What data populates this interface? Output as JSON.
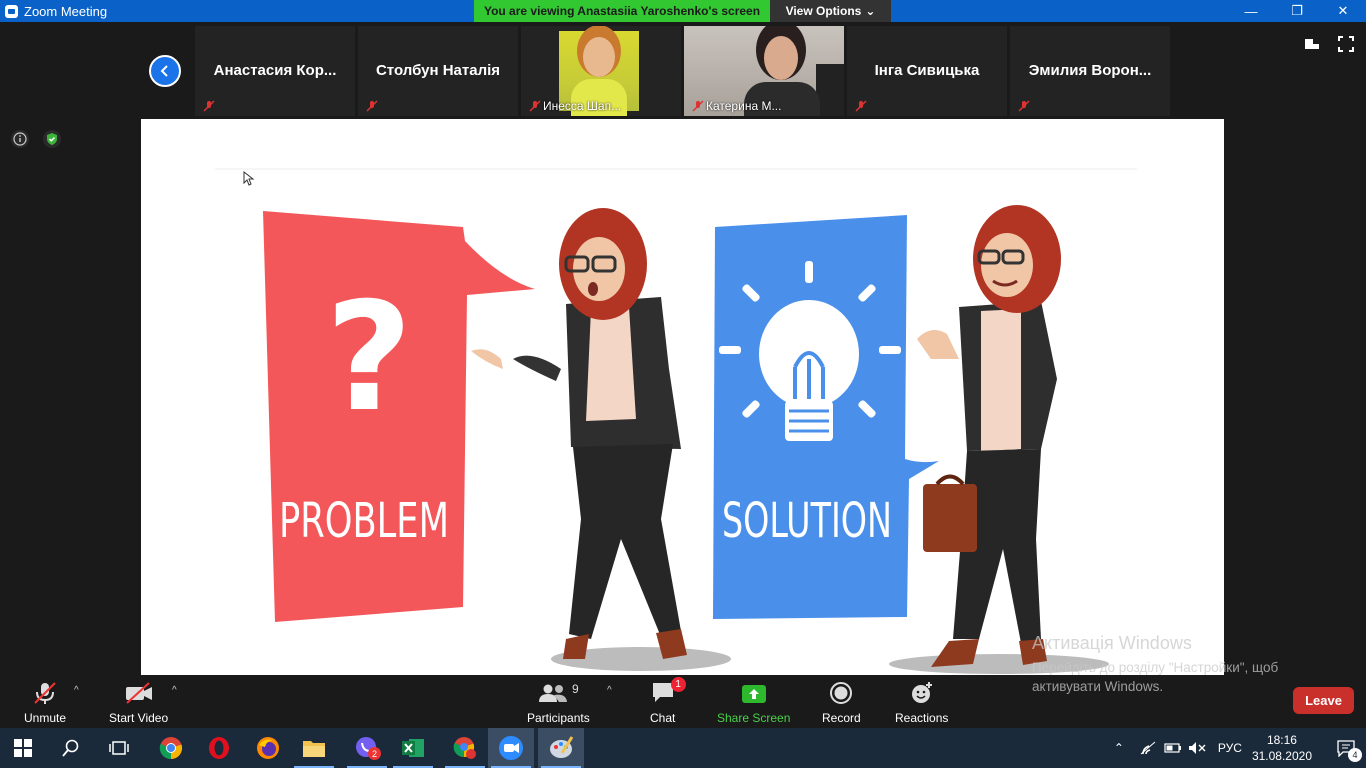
{
  "window": {
    "title": "Zoom Meeting",
    "viewing_banner": "You are viewing Anastasiia Yaroshenko's screen",
    "view_options": "View Options"
  },
  "participants": [
    {
      "name": "Анастасия  Кор...",
      "muted": true,
      "video": false
    },
    {
      "name": "Столбун Наталія",
      "muted": true,
      "video": false
    },
    {
      "name": "Инесса Шап...",
      "muted": true,
      "video": true
    },
    {
      "name": "Катерина М...",
      "muted": true,
      "video": true
    },
    {
      "name": "Інга Сивицька",
      "muted": true,
      "video": false
    },
    {
      "name": "Эмилия  Ворон...",
      "muted": true,
      "video": false
    }
  ],
  "slide": {
    "left_label": "PROBLEM",
    "right_label": "SOLUTION",
    "left_symbol": "?",
    "colors": {
      "problem": "#f4575a",
      "solution": "#4a90ea"
    }
  },
  "toolbar": {
    "unmute": "Unmute",
    "start_video": "Start Video",
    "participants": "Participants",
    "participants_count": "9",
    "chat": "Chat",
    "chat_badge": "1",
    "share_screen": "Share Screen",
    "record": "Record",
    "reactions": "Reactions",
    "leave": "Leave"
  },
  "activation_watermark": {
    "title": "Активація Windows",
    "line1": "Перейдіть до розділу \"Настройки\", щоб",
    "line2": "активувати Windows."
  },
  "taskbar": {
    "viber_badge": "2",
    "language": "РУС",
    "time": "18:16",
    "date": "31.08.2020",
    "notifications": "4"
  }
}
